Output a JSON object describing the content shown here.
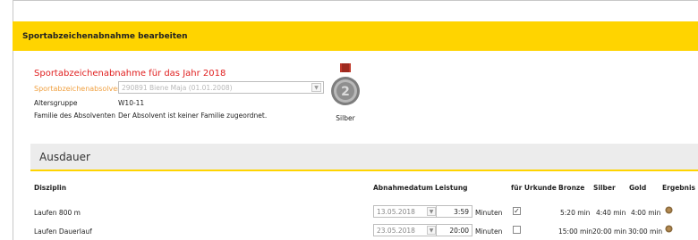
{
  "header": {
    "title": "Sportabzeichenabnahme bearbeiten"
  },
  "form": {
    "section_title": "Sportabzeichenabnahme für das Jahr 2018",
    "absolvent_label": "Sportabzeichenabsolvent",
    "absolvent_value": "290891 Biene Maja (01.01.2008)",
    "altersgruppe_label": "Altersgruppe",
    "altersgruppe_value": "W10-11",
    "familie_label": "Familie des Absolventen",
    "familie_value": "Der Absolvent ist keiner Familie zugeordnet.",
    "medal_label": "Silber"
  },
  "colors": {
    "accent": "#ffd400",
    "title_red": "#e02020",
    "label_orange": "#f0a040"
  },
  "ausdauer": {
    "title": "Ausdauer",
    "columns": {
      "disziplin": "Disziplin",
      "abnahmedatum": "Abnahmedatum",
      "leistung": "Leistung",
      "urkunde": "für Urkunde",
      "bronze": "Bronze",
      "silber": "Silber",
      "gold": "Gold",
      "ergebnis": "Ergebnis"
    },
    "rows": [
      {
        "disziplin": "Laufen 800 m",
        "date": "13.05.2018",
        "leistung": "3:59",
        "unit": "Minuten",
        "urkunde": true,
        "bronze": "5:20 min",
        "silber": "4:40 min",
        "gold": "4:00 min",
        "ergebnis_icon": "bronze-medal-icon"
      },
      {
        "disziplin": "Laufen Dauerlauf",
        "date": "23.05.2018",
        "leistung": "20:00",
        "unit": "Minuten",
        "urkunde": false,
        "bronze": "15:00 min",
        "silber": "20:00 min",
        "gold": "30:00 min",
        "ergebnis_icon": "bronze-medal-icon"
      }
    ]
  }
}
